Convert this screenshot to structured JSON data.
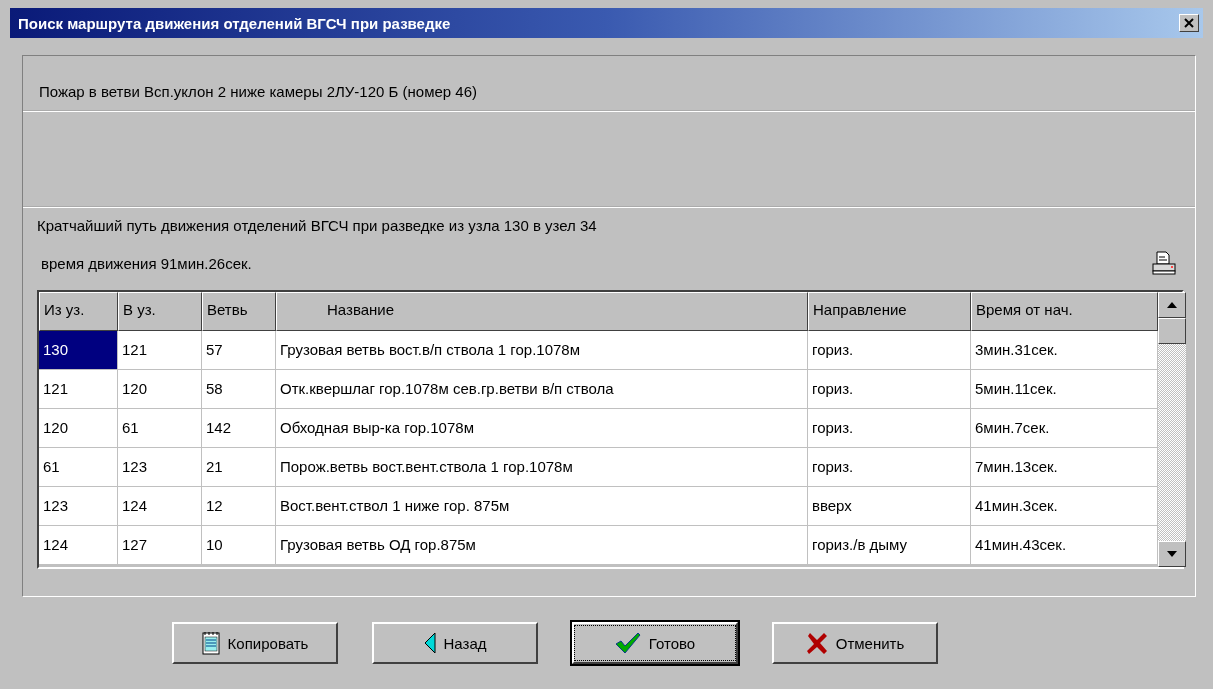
{
  "window": {
    "title": "Поиск маршрута движения отделений ВГСЧ при разведке"
  },
  "fire_info": "Пожар в ветви Всп.уклон 2 ниже камеры 2ЛУ-120 Б  (номер 46)",
  "route_info": "Кратчайший путь движения отделений ВГСЧ при разведке из узла  130  в узел  34",
  "travel_time": "время движения 91мин.26сек.",
  "table": {
    "columns": [
      "Из уз.",
      "В уз.",
      "Ветвь",
      "Название",
      "Направление",
      "Время от нач."
    ],
    "rows": [
      {
        "selected": true,
        "cells": [
          "130",
          "121",
          "57",
          "Грузовая ветвь вост.в/п ствола 1 гор.1078м",
          "гориз.",
          "3мин.31сек."
        ]
      },
      {
        "selected": false,
        "cells": [
          "121",
          "120",
          "58",
          "Отк.квершлаг гор.1078м сев.гр.ветви в/п ствола",
          "гориз.",
          "5мин.11сек."
        ]
      },
      {
        "selected": false,
        "cells": [
          "120",
          "61",
          "142",
          "Обходная выр-ка гор.1078м",
          "гориз.",
          "6мин.7сек."
        ]
      },
      {
        "selected": false,
        "cells": [
          "61",
          "123",
          "21",
          "Порож.ветвь вост.вент.ствола 1 гор.1078м",
          "гориз.",
          "7мин.13сек."
        ]
      },
      {
        "selected": false,
        "cells": [
          "123",
          "124",
          "12",
          "Вост.вент.ствол 1 ниже гор. 875м",
          "вверх",
          "41мин.3сек."
        ]
      },
      {
        "selected": false,
        "cells": [
          "124",
          "127",
          "10",
          "Грузовая ветвь ОД гор.875м",
          "гориз./в дыму",
          "41мин.43сек."
        ]
      }
    ]
  },
  "buttons": [
    {
      "kind": "copy",
      "label": "Копировать",
      "default": false
    },
    {
      "kind": "back",
      "label": "Назад",
      "default": false
    },
    {
      "kind": "done",
      "label": "Готово",
      "default": true
    },
    {
      "kind": "cancel",
      "label": "Отменить",
      "default": false
    }
  ]
}
